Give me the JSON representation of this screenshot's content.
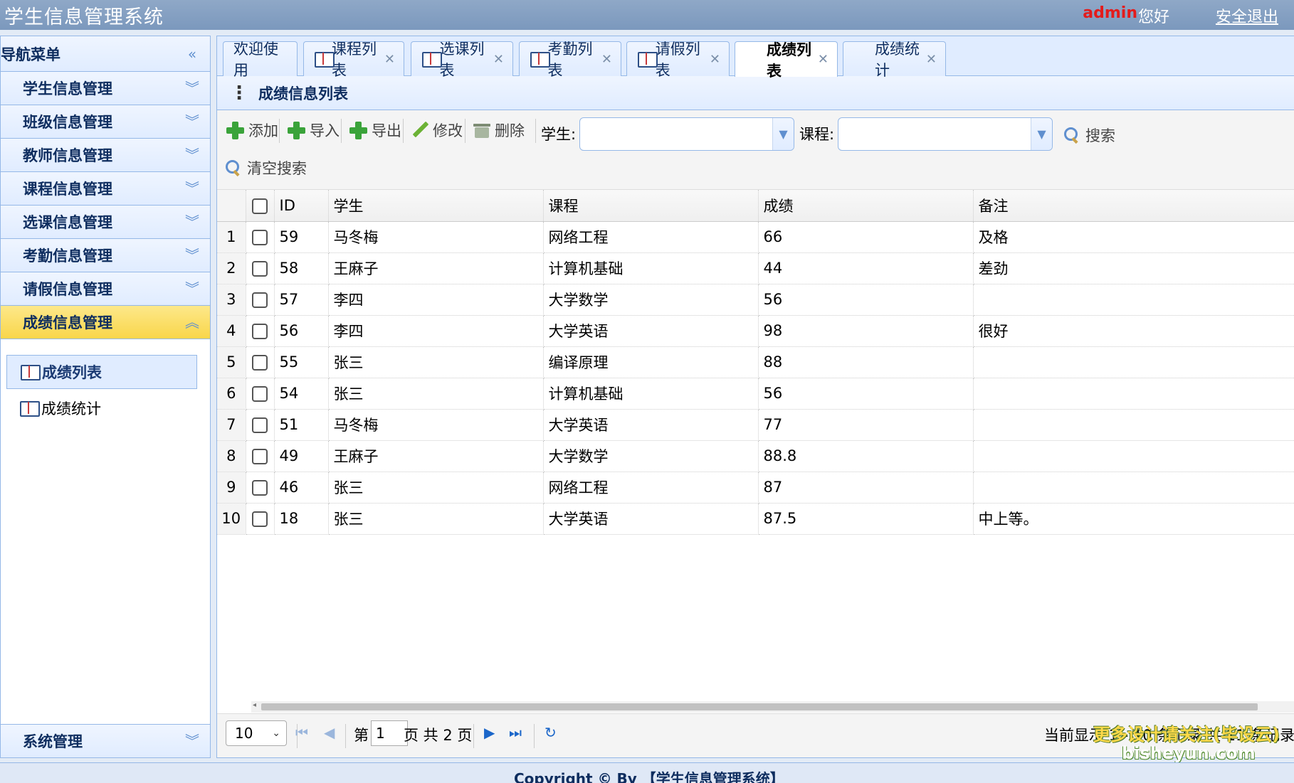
{
  "header": {
    "app_title": "学生信息管理系统",
    "user": "admin",
    "greeting": "您好",
    "logout": "安全退出"
  },
  "sidebar": {
    "title": "导航菜单",
    "sections": [
      {
        "label": "学生信息管理"
      },
      {
        "label": "班级信息管理"
      },
      {
        "label": "教师信息管理"
      },
      {
        "label": "课程信息管理"
      },
      {
        "label": "选课信息管理"
      },
      {
        "label": "考勤信息管理"
      },
      {
        "label": "请假信息管理"
      },
      {
        "label": "成绩信息管理"
      }
    ],
    "sub_items": [
      {
        "label": "成绩列表"
      },
      {
        "label": "成绩统计"
      }
    ],
    "bottom_section": "系统管理"
  },
  "tabs": [
    {
      "label": "欢迎使用"
    },
    {
      "label": "课程列表"
    },
    {
      "label": "选课列表"
    },
    {
      "label": "考勤列表"
    },
    {
      "label": "请假列表"
    },
    {
      "label": "成绩列表"
    },
    {
      "label": "成绩统计"
    }
  ],
  "panel": {
    "title": "成绩信息列表"
  },
  "toolbar": {
    "add": "添加",
    "import": "导入",
    "export": "导出",
    "edit": "修改",
    "delete": "删除",
    "student_label": "学生:",
    "course_label": "课程:",
    "search": "搜索",
    "clear_search": "清空搜索"
  },
  "table": {
    "columns": [
      "ID",
      "学生",
      "课程",
      "成绩",
      "备注"
    ],
    "rows": [
      {
        "n": "1",
        "id": "59",
        "student": "马冬梅",
        "course": "网络工程",
        "score": "66",
        "remark": "及格"
      },
      {
        "n": "2",
        "id": "58",
        "student": "王麻子",
        "course": "计算机基础",
        "score": "44",
        "remark": "差劲"
      },
      {
        "n": "3",
        "id": "57",
        "student": "李四",
        "course": "大学数学",
        "score": "56",
        "remark": ""
      },
      {
        "n": "4",
        "id": "56",
        "student": "李四",
        "course": "大学英语",
        "score": "98",
        "remark": "很好"
      },
      {
        "n": "5",
        "id": "55",
        "student": "张三",
        "course": "编译原理",
        "score": "88",
        "remark": ""
      },
      {
        "n": "6",
        "id": "54",
        "student": "张三",
        "course": "计算机基础",
        "score": "56",
        "remark": ""
      },
      {
        "n": "7",
        "id": "51",
        "student": "马冬梅",
        "course": "大学英语",
        "score": "77",
        "remark": ""
      },
      {
        "n": "8",
        "id": "49",
        "student": "王麻子",
        "course": "大学数学",
        "score": "88.8",
        "remark": ""
      },
      {
        "n": "9",
        "id": "46",
        "student": "张三",
        "course": "网络工程",
        "score": "87",
        "remark": ""
      },
      {
        "n": "10",
        "id": "18",
        "student": "张三",
        "course": "大学英语",
        "score": "87.5",
        "remark": "中上等。"
      }
    ]
  },
  "pager": {
    "page_size": "10",
    "page_prefix": "第",
    "current_page": "1",
    "page_suffix": "页 共 2 页",
    "info": "当前显示 1 - 10 条记录   共 11 条记录"
  },
  "watermark": {
    "line1": "更多设计请关注(毕设云)",
    "line2": "bisheyun.com"
  },
  "footer": {
    "copyright": "Copyright © By 【学生信息管理系统】"
  }
}
